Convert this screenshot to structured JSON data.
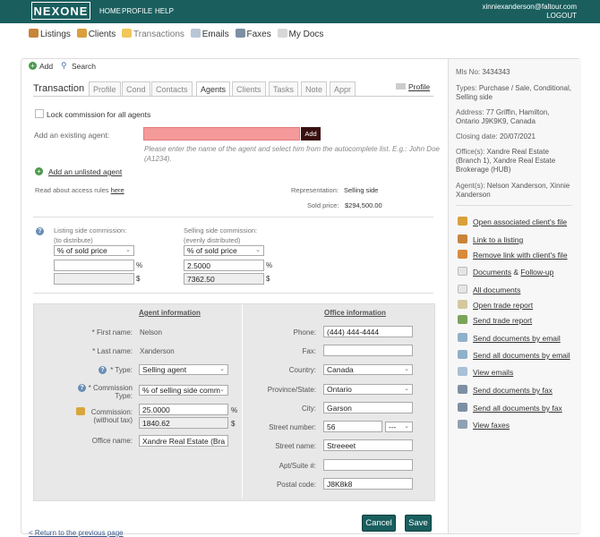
{
  "brand": {
    "logo_text": "NEXONE",
    "color": "#1a5e5e"
  },
  "topnav": {
    "home": "HOME",
    "profile": "PROFILE",
    "help": "HELP"
  },
  "user": {
    "email": "xinniexanderson@faltour.com",
    "logout": "LOGOUT"
  },
  "subnav": {
    "items": [
      {
        "label": "Listings",
        "icon": "house-icon"
      },
      {
        "label": "Clients",
        "icon": "people-icon"
      },
      {
        "label": "Transactions",
        "icon": "folder-icon"
      },
      {
        "label": "Emails",
        "icon": "envelope-icon"
      },
      {
        "label": "Faxes",
        "icon": "fax-icon"
      },
      {
        "label": "My Docs",
        "icon": "documents-icon"
      }
    ]
  },
  "actions": {
    "add": "Add",
    "search": "Search"
  },
  "tabs": {
    "title": "Transaction",
    "items": [
      "Profile",
      "Cond",
      "Contacts",
      "Agents",
      "Clients",
      "Tasks",
      "Note",
      "Appr"
    ],
    "active": "Agents",
    "profile_link": "Profile"
  },
  "agents": {
    "lock_label": "Lock commission for all agents",
    "add_existing_label": "Add an existing agent:",
    "add_button": "Add",
    "hint": "Please enter the name of the agent and select him from the autocomplete list. E.g.: John Doe (A1234).",
    "add_unlisted": "Add an unlisted agent",
    "access_rules_prefix": "Read about access rules",
    "access_rules_link": "here",
    "representation_label": "Representation:",
    "representation_value": "Selling side",
    "sold_price_label": "Sold price:",
    "sold_price_value": "$294,500.00"
  },
  "commission": {
    "listing_label": "Listing side commission:",
    "listing_sub": "(to distribute)",
    "listing_type": "% of sold price",
    "listing_pct": "",
    "listing_amount": "",
    "selling_label": "Selling side commission:",
    "selling_sub": "(evenly distributed)",
    "selling_type": "% of sold price",
    "selling_pct": "2.5000",
    "selling_amount": "7362.50",
    "pct_sign": "%",
    "dollar_sign": "$"
  },
  "agent_info": {
    "header": "Agent information",
    "first_name_label": "* First name:",
    "first_name": "Nelson",
    "last_name_label": "* Last name:",
    "last_name": "Xanderson",
    "type_label": "* Type:",
    "type_value": "Selling agent",
    "commission_type_label": "* Commission",
    "commission_type_label2": "Type:",
    "commission_type_value": "% of selling side comm",
    "commission_label": "Commission:",
    "commission_label2": "(without tax)",
    "commission_pct": "25.0000",
    "commission_amount": "1840.62",
    "office_name_label": "Office name:",
    "office_name": "Xandre Real Estate (Bra"
  },
  "office_info": {
    "header": "Office information",
    "phone_label": "Phone:",
    "phone": "(444) 444-4444",
    "fax_label": "Fax:",
    "fax": "",
    "country_label": "Country:",
    "country": "Canada",
    "province_label": "Province/State:",
    "province": "Ontario",
    "city_label": "City:",
    "city": "Garson",
    "street_number_label": "Street number:",
    "street_number": "56",
    "street_suffix": "---",
    "street_name_label": "Street name:",
    "street_name": "Streeeet",
    "apt_label": "Apt/Suite #:",
    "apt": "",
    "postal_label": "Postal code:",
    "postal": "J8K8k8"
  },
  "buttons": {
    "cancel": "Cancel",
    "save": "Save"
  },
  "back_link": "< Return to the previous page",
  "sidebar": {
    "mls_label": "Mls No:",
    "mls": "3434343",
    "types_label": "Types:",
    "types": "Purchase / Sale, Conditional, Selling side",
    "address_label": "Address:",
    "address": "77 Griffin, Hamilton, Ontario J9K9K9, Canada",
    "closing_label": "Closing date:",
    "closing": "20/07/2021",
    "offices_label": "Office(s):",
    "offices": "Xandre Real Estate (Branch 1), Xandre Real Estate Brokerage (HUB)",
    "agents_label": "Agent(s):",
    "agents": "Nelson Xanderson, Xinnie Xanderson",
    "links": [
      {
        "label": "Open associated client's file",
        "icon": "client-file-icon"
      },
      {
        "label": "Link to a listing",
        "icon": "house-link-icon"
      },
      {
        "label": "Remove link with client's file",
        "icon": "client-remove-icon"
      },
      {
        "label_a": "Documents",
        "amp": "&",
        "label_b": "Follow-up",
        "icon": "document-icon"
      },
      {
        "label": "All documents",
        "icon": "all-documents-icon"
      },
      {
        "label": "Open trade report",
        "icon": "report-icon"
      },
      {
        "label": "Send trade report",
        "icon": "send-report-icon"
      },
      {
        "label": "Send documents by email",
        "icon": "email-docs-icon"
      },
      {
        "label": "Send all documents by email",
        "icon": "email-all-icon"
      },
      {
        "label": "View emails",
        "icon": "view-emails-icon"
      },
      {
        "label": "Send documents by fax",
        "icon": "fax-docs-icon"
      },
      {
        "label": "Send all documents by fax",
        "icon": "fax-all-icon"
      },
      {
        "label": "View faxes",
        "icon": "view-faxes-icon"
      }
    ]
  }
}
